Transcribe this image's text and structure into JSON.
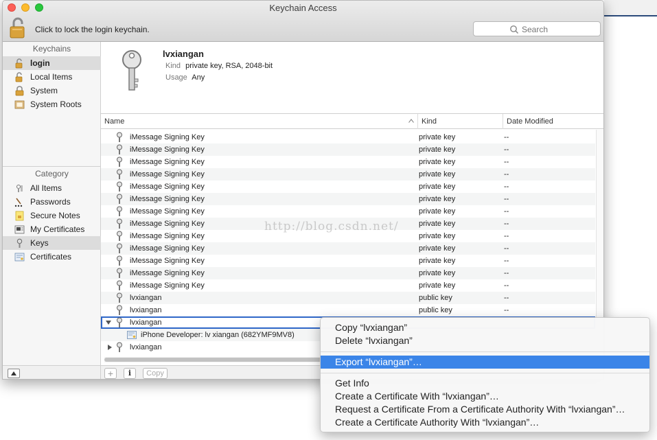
{
  "window": {
    "title": "Keychain Access"
  },
  "toolbar": {
    "lock_text": "Click to lock the login keychain.",
    "search_placeholder": "Search"
  },
  "sidebar": {
    "keychains_header": "Keychains",
    "keychains": [
      {
        "label": "login",
        "icon": "unlocked-padlock-icon",
        "selected": true
      },
      {
        "label": "Local Items",
        "icon": "unlocked-padlock-icon",
        "selected": false
      },
      {
        "label": "System",
        "icon": "locked-padlock-icon",
        "selected": false
      },
      {
        "label": "System Roots",
        "icon": "certificate-cabinet-icon",
        "selected": false
      }
    ],
    "category_header": "Category",
    "categories": [
      {
        "label": "All Items",
        "icon": "all-items-icon",
        "selected": false
      },
      {
        "label": "Passwords",
        "icon": "password-dots-icon",
        "selected": false
      },
      {
        "label": "Secure Notes",
        "icon": "secure-note-icon",
        "selected": false
      },
      {
        "label": "My Certificates",
        "icon": "my-certificates-icon",
        "selected": false
      },
      {
        "label": "Keys",
        "icon": "key-icon",
        "selected": true
      },
      {
        "label": "Certificates",
        "icon": "certificate-icon",
        "selected": false
      }
    ]
  },
  "detail": {
    "name": "lvxiangan",
    "kind_label": "Kind",
    "kind_value": "private key, RSA, 2048-bit",
    "usage_label": "Usage",
    "usage_value": "Any"
  },
  "table": {
    "columns": {
      "name": "Name",
      "kind": "Kind",
      "date": "Date Modified"
    },
    "rows": [
      {
        "name": "iMessage Signing Key",
        "kind": "private key",
        "date": "--"
      },
      {
        "name": "iMessage Signing Key",
        "kind": "private key",
        "date": "--"
      },
      {
        "name": "iMessage Signing Key",
        "kind": "private key",
        "date": "--"
      },
      {
        "name": "iMessage Signing Key",
        "kind": "private key",
        "date": "--"
      },
      {
        "name": "iMessage Signing Key",
        "kind": "private key",
        "date": "--"
      },
      {
        "name": "iMessage Signing Key",
        "kind": "private key",
        "date": "--"
      },
      {
        "name": "iMessage Signing Key",
        "kind": "private key",
        "date": "--"
      },
      {
        "name": "iMessage Signing Key",
        "kind": "private key",
        "date": "--"
      },
      {
        "name": "iMessage Signing Key",
        "kind": "private key",
        "date": "--"
      },
      {
        "name": "iMessage Signing Key",
        "kind": "private key",
        "date": "--"
      },
      {
        "name": "iMessage Signing Key",
        "kind": "private key",
        "date": "--"
      },
      {
        "name": "iMessage Signing Key",
        "kind": "private key",
        "date": "--"
      },
      {
        "name": "iMessage Signing Key",
        "kind": "private key",
        "date": "--"
      },
      {
        "name": "lvxiangan",
        "kind": "public key",
        "date": "--"
      },
      {
        "name": "lvxiangan",
        "kind": "public key",
        "date": "--"
      },
      {
        "name": "lvxiangan",
        "kind": "",
        "date": ""
      },
      {
        "name": "iPhone Developer: lv xiangan (682YMF9MV8)",
        "kind": "",
        "date": ""
      },
      {
        "name": "lvxiangan",
        "kind": "",
        "date": ""
      }
    ]
  },
  "watermark": "http://blog.csdn.net/",
  "bottombar": {
    "add": "+",
    "info": "i",
    "copy": "Copy"
  },
  "context_menu": {
    "items": [
      "Copy “lvxiangan”",
      "Delete “lvxiangan”",
      "Export “lvxiangan”…",
      "Get Info",
      "Create a Certificate With “lvxiangan”…",
      "Request a Certificate From a Certificate Authority With “lvxiangan”…",
      "Create a Certificate Authority With “lvxiangan”…"
    ],
    "highlighted_index": 2
  },
  "colors": {
    "selection": "#2e66c8",
    "menu_highlight": "#3b85e8",
    "sidebar_selected": "#dcdcdc"
  }
}
